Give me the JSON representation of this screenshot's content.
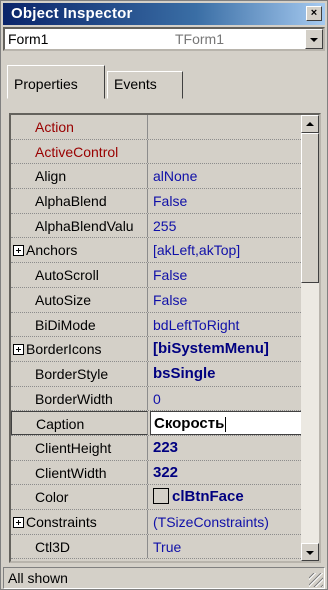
{
  "window": {
    "title": "Object Inspector",
    "close_glyph": "×"
  },
  "combo": {
    "name": "Form1",
    "type": "TForm1"
  },
  "tabs": [
    {
      "label": "Properties"
    },
    {
      "label": "Events"
    }
  ],
  "properties": [
    {
      "name": "Action",
      "value": "",
      "expand": false,
      "red": true
    },
    {
      "name": "ActiveControl",
      "value": "",
      "expand": false,
      "red": true
    },
    {
      "name": "Align",
      "value": "alNone",
      "expand": false
    },
    {
      "name": "AlphaBlend",
      "value": "False",
      "expand": false
    },
    {
      "name": "AlphaBlendValu",
      "value": "255",
      "expand": false
    },
    {
      "name": "Anchors",
      "value": "[akLeft,akTop]",
      "expand": true
    },
    {
      "name": "AutoScroll",
      "value": "False",
      "expand": false
    },
    {
      "name": "AutoSize",
      "value": "False",
      "expand": false
    },
    {
      "name": "BiDiMode",
      "value": "bdLeftToRight",
      "expand": false
    },
    {
      "name": "BorderIcons",
      "value": "[biSystemMenu]",
      "expand": true,
      "bold": true
    },
    {
      "name": "BorderStyle",
      "value": "bsSingle",
      "expand": false,
      "bold": true
    },
    {
      "name": "BorderWidth",
      "value": "0",
      "expand": false
    },
    {
      "name": "Caption",
      "value": "Скорость",
      "expand": false,
      "selected": true
    },
    {
      "name": "ClientHeight",
      "value": "223",
      "expand": false,
      "bold": true
    },
    {
      "name": "ClientWidth",
      "value": "322",
      "expand": false,
      "bold": true
    },
    {
      "name": "Color",
      "value": "clBtnFace",
      "expand": false,
      "bold": true,
      "swatch": "#d4d0c8"
    },
    {
      "name": "Constraints",
      "value": "(TSizeConstraints)",
      "expand": true
    },
    {
      "name": "Ctl3D",
      "value": "True",
      "expand": false
    }
  ],
  "status": {
    "text": "All shown"
  }
}
